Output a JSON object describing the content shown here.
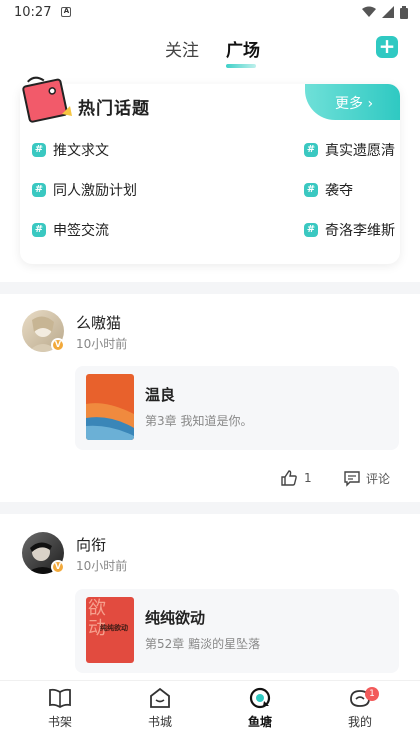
{
  "status_bar": {
    "time": "10:27",
    "notif_icon": "A"
  },
  "tabs": {
    "follow": "关注",
    "square": "广场"
  },
  "topics": {
    "title": "热门话题",
    "more": "更多 ›",
    "items": [
      "推文求文",
      "真实遗愿清",
      "同人激励计划",
      "袭夺",
      "申签交流",
      "奇洛李维斯"
    ]
  },
  "posts": [
    {
      "username": "么嗷猫",
      "time": "10小时前",
      "book_title": "温良",
      "book_chapter": "第3章 我知道是你。",
      "likes": "1",
      "comment_label": "评论"
    },
    {
      "username": "向衔",
      "time": "10小时前",
      "book_title": "纯纯欲动",
      "book_chapter": "第52章 黯淡的星坠落",
      "cover_text": "欲动",
      "cover_title": "纯纯欲动"
    }
  ],
  "nav": {
    "bookshelf": "书架",
    "bookstore": "书城",
    "fishpond": "鱼塘",
    "mine": "我的",
    "mine_badge": "1"
  },
  "colors": {
    "accent": "#2fc9c2",
    "badge": "#f25a5a",
    "verified": "#f2a93b"
  }
}
